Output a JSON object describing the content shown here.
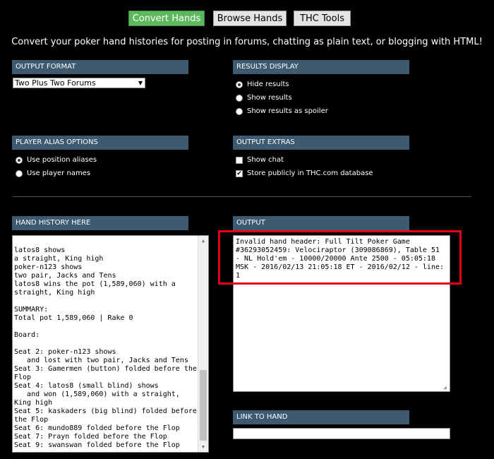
{
  "tabs": [
    {
      "label": "Convert Hands",
      "active": true
    },
    {
      "label": "Browse Hands",
      "active": false
    },
    {
      "label": "THC Tools",
      "active": false
    }
  ],
  "tagline": "Convert your poker hand histories for posting in forums, chatting as plain text, or blogging with HTML!",
  "output_format": {
    "header": "OUTPUT FORMAT",
    "selected": "Two Plus Two Forums"
  },
  "results_display": {
    "header": "RESULTS DISPLAY",
    "options": [
      "Hide results",
      "Show results",
      "Show results as spoiler"
    ],
    "selected_index": 0
  },
  "player_alias": {
    "header": "PLAYER ALIAS OPTIONS",
    "options": [
      "Use position aliases",
      "Use player names"
    ],
    "selected_index": 0
  },
  "output_extras": {
    "header": "OUTPUT EXTRAS",
    "options": [
      {
        "label": "Show chat",
        "checked": false
      },
      {
        "label": "Store publicly in THC.com database",
        "checked": true
      }
    ]
  },
  "hand_history": {
    "header": "HAND HISTORY HERE",
    "text": "latos8 shows\na straight, King high\npoker-n123 shows\ntwo pair, Jacks and Tens\nlatos8 wins the pot (1,589,060) with a\nstraight, King high\n\nSUMMARY:\nTotal pot 1,589,060 | Rake 0\n\nBoard:\n\nSeat 2: poker-n123 shows\n   and lost with two pair, Jacks and Tens\nSeat 3: Gamermen (button) folded before the\nFlop\nSeat 4: latos8 (small blind) shows\n   and won (1,589,060) with a straight,\nKing high\nSeat 5: kaskaders (big blind) folded before\nthe Flop\nSeat 6: mundo889 folded before the Flop\nSeat 7: Prayn folded before the Flop\nSeat 9: swanswan folded before the Flop"
  },
  "output": {
    "header": "OUTPUT",
    "text": "Invalid hand header: Full Tilt Poker Game #36293052459: Velociraptor (309086869), Table 51 - NL Hold'em - 10000/20000 Ante 2500 - 05:05:18 MSK - 2016/02/13 21:05:18 ET - 2016/02/12 - line: 1"
  },
  "link_to_hand": {
    "header": "LINK TO HAND",
    "value": ""
  },
  "colors": {
    "active_tab": "#5cb85c",
    "panel_header": "#3d5a70",
    "highlight_box": "#e3001b"
  }
}
